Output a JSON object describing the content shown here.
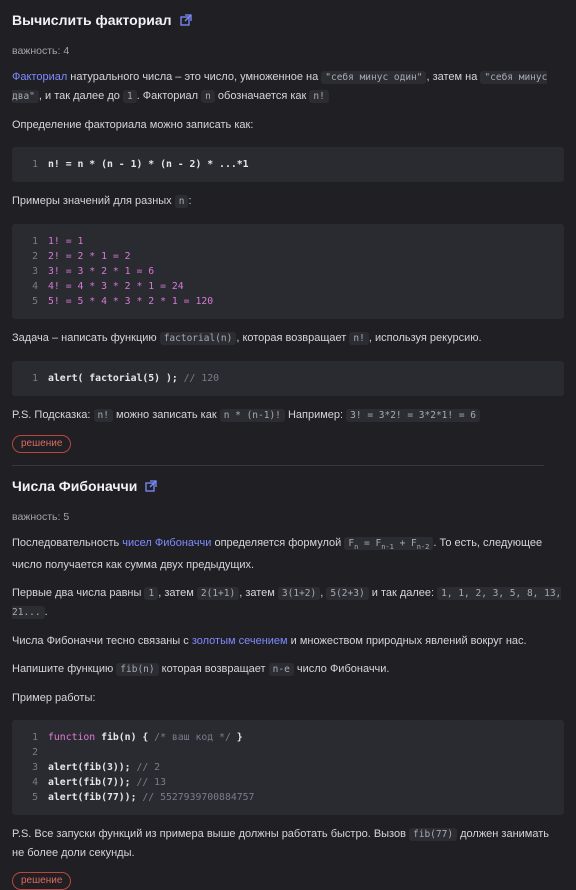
{
  "task1": {
    "title": "Вычислить факториал",
    "importance": "важность: 4",
    "intro": {
      "link": "Факториал",
      "t1": " натурального числа – это число, умноженное на ",
      "c1": "\"себя минус один\"",
      "t2": ", затем на ",
      "c2": "\"себя минус два\"",
      "t3": ", и так далее до ",
      "c3": "1",
      "t4": ". Факториал ",
      "c4": "n",
      "t5": " обозначается как ",
      "c5": "n!"
    },
    "definition_text": "Определение факториала можно записать как:",
    "definition_code": [
      "n! = n * (n - 1) * (n - 2) * ...*1"
    ],
    "examples_text": "Примеры значений для разных ",
    "examples_code_var": "n",
    "examples_colon": ":",
    "examples_code": [
      "1! = 1",
      "2! = 2 * 1 = 2",
      "3! = 3 * 2 * 1 = 6",
      "4! = 4 * 3 * 2 * 1 = 24",
      "5! = 5 * 4 * 3 * 2 * 1 = 120"
    ],
    "task": {
      "t1": "Задача – написать функцию ",
      "c1": "factorial(n)",
      "t2": ", которая возвращает ",
      "c2": "n!",
      "t3": ", используя рекурсию."
    },
    "alert_code": {
      "a": "alert( factorial(5) );",
      "c": " // 120"
    },
    "hint": {
      "t1": "P.S. Подсказка: ",
      "c1": "n!",
      "t2": " можно записать как ",
      "c2": "n * (n-1)!",
      "t3": " Например: ",
      "c3": "3! = 3*2! = 3*2*1! = 6"
    },
    "solution": "решение"
  },
  "task2": {
    "title": "Числа Фибоначчи",
    "importance": "важность: 5",
    "p1": {
      "t1": "Последовательность ",
      "link": "чисел Фибоначчи",
      "t2": " определяется формулой ",
      "f1": "F",
      "s1": "n",
      "f2": " = F",
      "s2": "n-1",
      "f3": " + F",
      "s3": "n-2",
      "t3": ". То есть, следующее число получается как сумма двух предыдущих."
    },
    "p2": {
      "t1": "Первые два числа равны ",
      "c1": "1",
      "t2": ", затем ",
      "c2": "2(1+1)",
      "t3": ", затем ",
      "c3": "3(1+2)",
      "t4": ", ",
      "c4": "5(2+3)",
      "t5": " и так далее: ",
      "c5": "1, 1, 2, 3, 5, 8, 13, 21...",
      "t6": "."
    },
    "p3": {
      "t1": "Числа Фибоначчи тесно связаны с ",
      "link": "золотым сечением",
      "t2": " и множеством природных явлений вокруг нас."
    },
    "p4": {
      "t1": "Напишите функцию ",
      "c1": "fib(n)",
      "t2": " которая возвращает ",
      "c2": "n-е",
      "t3": " число Фибоначчи."
    },
    "p5": "Пример работы:",
    "code": {
      "l1a": "function",
      "l1b": " fib(n) { ",
      "l1c": "/* ваш код */",
      "l1d": " }",
      "l3a": "alert(fib(3));",
      "l3c": " // 2",
      "l4a": "alert(fib(7));",
      "l4c": " // 13",
      "l5a": "alert(fib(77));",
      "l5c": " // 5527939700884757"
    },
    "ps": {
      "t1": "P.S. Все запуски функций из примера выше должны работать быстро. Вызов ",
      "c1": "fib(77)",
      "t2": " должен занимать не более доли секунды."
    },
    "solution": "решение"
  },
  "colors": {
    "background": "#1f1f24",
    "link": "#7d8cff",
    "solution": "#e06a60",
    "code_bg": "#2a2a31"
  }
}
